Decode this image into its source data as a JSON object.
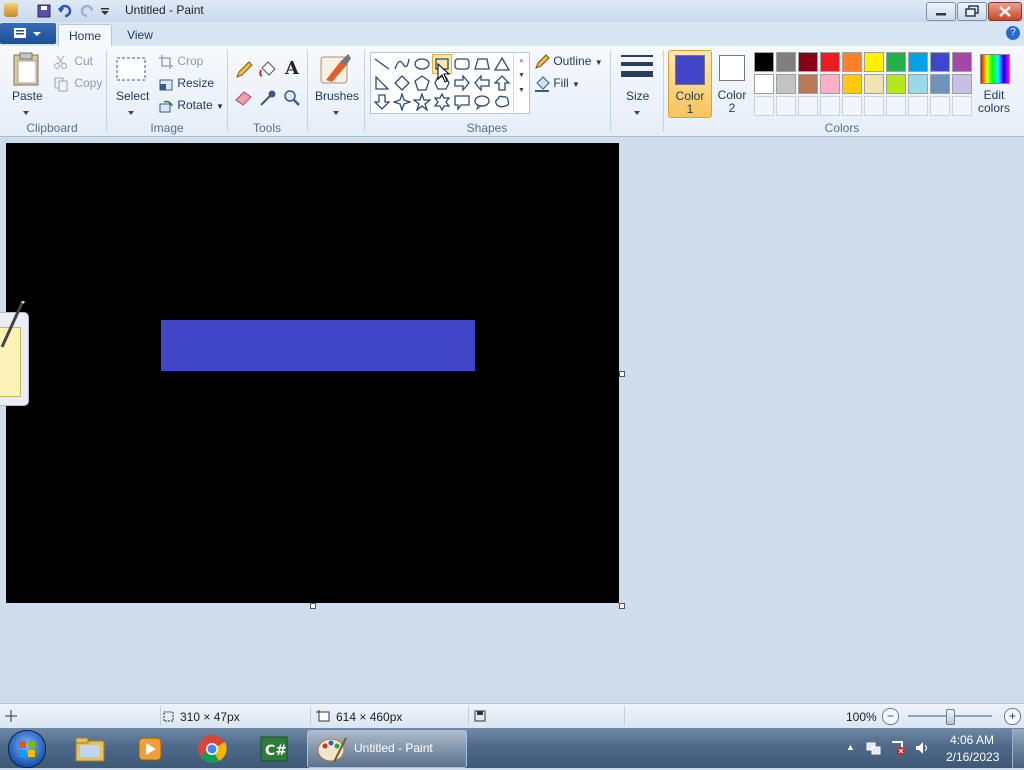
{
  "window": {
    "title": "Untitled - Paint"
  },
  "tabs": [
    {
      "label": "Home"
    },
    {
      "label": "View"
    }
  ],
  "clipboard": {
    "paste": "Paste",
    "cut": "Cut",
    "copy": "Copy",
    "group": "Clipboard"
  },
  "image": {
    "select": "Select",
    "crop": "Crop",
    "resize": "Resize",
    "rotate": "Rotate",
    "group": "Image"
  },
  "tools": {
    "group": "Tools"
  },
  "brushes": {
    "label": "Brushes"
  },
  "shapes": {
    "outline": "Outline",
    "fill": "Fill",
    "group": "Shapes"
  },
  "size": {
    "label": "Size"
  },
  "colors": {
    "color1_line1": "Color",
    "color1_line2": "1",
    "color2_line1": "Color",
    "color2_line2": "2",
    "edit_line1": "Edit",
    "edit_line2": "colors",
    "group": "Colors",
    "color1_value": "#4145c8",
    "row1": [
      "#000000",
      "#7f7f7f",
      "#880015",
      "#ed1c24",
      "#ff7f27",
      "#fff200",
      "#22b14c",
      "#00a2e8",
      "#3f48cc",
      "#a349a4"
    ],
    "row2": [
      "#ffffff",
      "#c3c3c3",
      "#b97a57",
      "#ffaec9",
      "#ffc90e",
      "#efe4b0",
      "#b5e61d",
      "#99d9ea",
      "#7092be",
      "#c8bfe7"
    ]
  },
  "canvas": {
    "background": "#000000",
    "shape_fill": "#4145c8"
  },
  "status": {
    "selection_size": "310 × 47px",
    "canvas_size": "614 × 460px",
    "zoom": "100%"
  },
  "taskbar": {
    "paint_label": "Untitled - Paint",
    "time": "4:06 AM",
    "date": "2/16/2023"
  }
}
